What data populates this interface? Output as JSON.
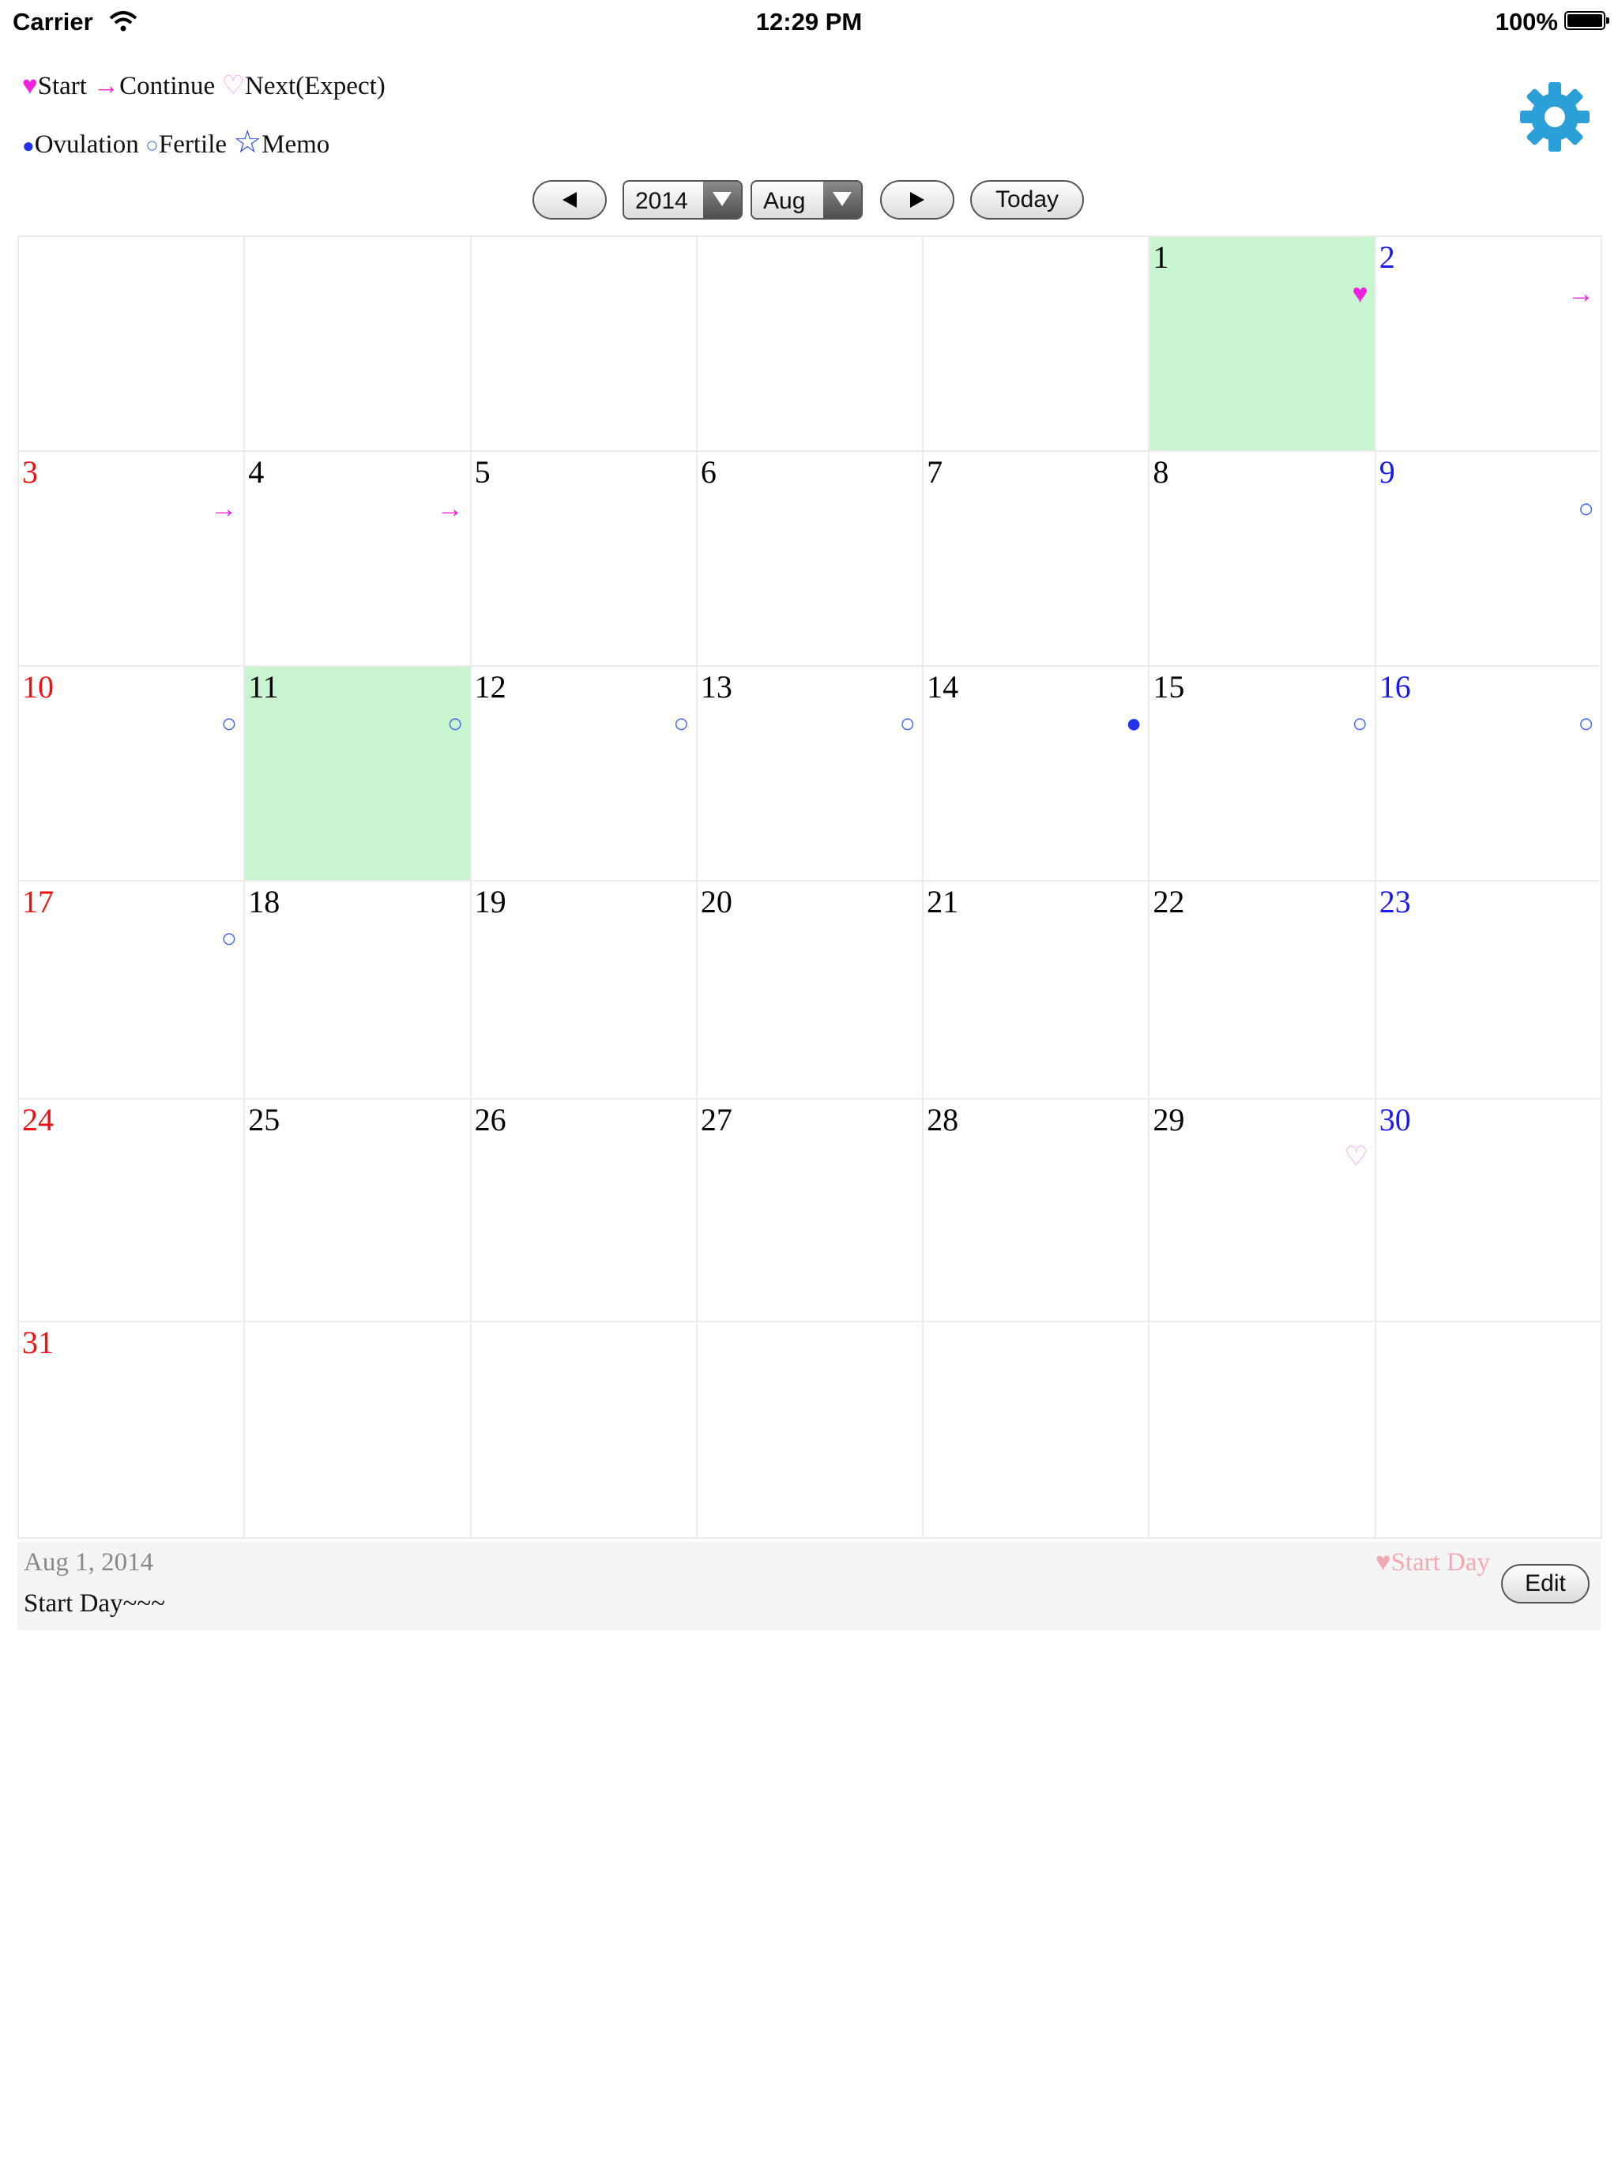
{
  "status": {
    "carrier": "Carrier",
    "time": "12:29 PM",
    "battery": "100%"
  },
  "legend": {
    "start_icon": "♥",
    "start": "Start",
    "continue_icon": "→",
    "continue": "Continue",
    "next_icon": "♡",
    "next": "Next(Expect)",
    "ovulation_icon": "●",
    "ovulation": "Ovulation",
    "fertile_icon": "○",
    "fertile": "Fertile",
    "memo_icon": "☆",
    "memo": "Memo"
  },
  "nav": {
    "year": "2014",
    "month": "Aug",
    "today": "Today"
  },
  "colors": {
    "selected": "#c8f4d0",
    "sunday": "#ee1111",
    "saturday": "#1a1aee",
    "period": "#ee22dd",
    "fertile": "#4466ee"
  },
  "calendar": {
    "weeks": [
      [
        {
          "day": ""
        },
        {
          "day": ""
        },
        {
          "day": ""
        },
        {
          "day": ""
        },
        {
          "day": ""
        },
        {
          "day": "1",
          "mark": "♥",
          "mark_type": "heart",
          "selected": true
        },
        {
          "day": "2",
          "mark": "→",
          "mark_type": "arrow"
        }
      ],
      [
        {
          "day": "3",
          "mark": "→",
          "mark_type": "arrow"
        },
        {
          "day": "4",
          "mark": "→",
          "mark_type": "arrow"
        },
        {
          "day": "5"
        },
        {
          "day": "6"
        },
        {
          "day": "7"
        },
        {
          "day": "8"
        },
        {
          "day": "9",
          "mark": "○",
          "mark_type": "circ"
        }
      ],
      [
        {
          "day": "10",
          "mark": "○",
          "mark_type": "circ"
        },
        {
          "day": "11",
          "mark": "○",
          "mark_type": "circ",
          "selected": true
        },
        {
          "day": "12",
          "mark": "○",
          "mark_type": "circ"
        },
        {
          "day": "13",
          "mark": "○",
          "mark_type": "circ"
        },
        {
          "day": "14",
          "mark": "●",
          "mark_type": "dot"
        },
        {
          "day": "15",
          "mark": "○",
          "mark_type": "circ"
        },
        {
          "day": "16",
          "mark": "○",
          "mark_type": "circ"
        }
      ],
      [
        {
          "day": "17",
          "mark": "○",
          "mark_type": "circ"
        },
        {
          "day": "18"
        },
        {
          "day": "19"
        },
        {
          "day": "20"
        },
        {
          "day": "21"
        },
        {
          "day": "22"
        },
        {
          "day": "23"
        }
      ],
      [
        {
          "day": "24"
        },
        {
          "day": "25"
        },
        {
          "day": "26"
        },
        {
          "day": "27"
        },
        {
          "day": "28"
        },
        {
          "day": "29",
          "mark": "♡",
          "mark_type": "heart-o"
        },
        {
          "day": "30"
        }
      ],
      [
        {
          "day": "31"
        },
        {
          "day": ""
        },
        {
          "day": ""
        },
        {
          "day": ""
        },
        {
          "day": ""
        },
        {
          "day": ""
        },
        {
          "day": ""
        }
      ]
    ]
  },
  "detail": {
    "date": "Aug 1, 2014",
    "memo": "Start Day~~~",
    "tag": "♥Start Day",
    "edit": "Edit"
  }
}
